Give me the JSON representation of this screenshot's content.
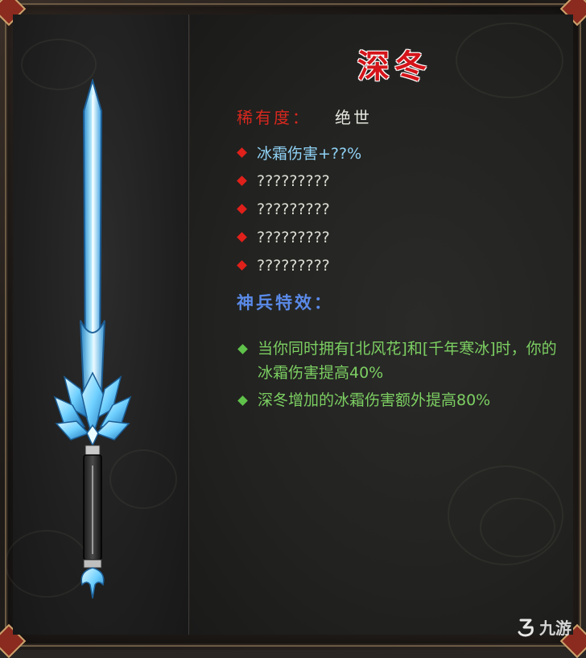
{
  "item": {
    "name": "深冬",
    "rarity_label": "稀有度：",
    "rarity_value": "绝世"
  },
  "attributes": [
    {
      "text": "冰霜伤害+??%",
      "known": true
    },
    {
      "text": "?????????",
      "known": false
    },
    {
      "text": "?????????",
      "known": false
    },
    {
      "text": "?????????",
      "known": false
    },
    {
      "text": "?????????",
      "known": false
    }
  ],
  "special_effects": {
    "heading": "神兵特效：",
    "items": [
      {
        "text": "当你同时拥有[北风花]和[千年寒冰]时，你的冰霜伤害提高40%"
      },
      {
        "text": "深冬增加的冰霜伤害额外提高80%"
      }
    ]
  },
  "watermark": {
    "text": "九游",
    "icon": "jiuyou-logo-icon"
  },
  "colors": {
    "title": "#d4141a",
    "rarity_label": "#d8281e",
    "known_attr": "#8fd2f5",
    "unknown_attr": "#dcdcd4",
    "effect_heading": "#5a8ae8",
    "effect_text": "#7ccf62",
    "sword_blade": "#7fd8ff"
  },
  "icons": {
    "attribute_bullet": "red-diamond-icon",
    "effect_bullet": "green-diamond-icon",
    "item_image": "ice-sword-icon"
  }
}
